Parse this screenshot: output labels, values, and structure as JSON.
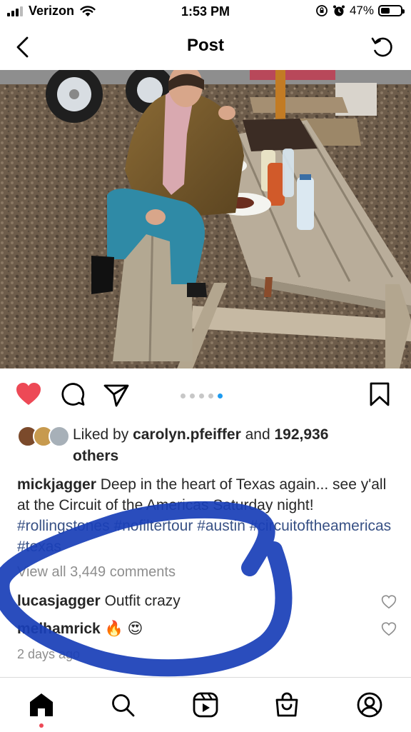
{
  "status_bar": {
    "carrier": "Verizon",
    "time": "1:53 PM",
    "battery_text": "47%",
    "battery_level": 0.47
  },
  "header": {
    "title": "Post"
  },
  "post": {
    "image_count": 5,
    "active_image_index": 4,
    "liked": true,
    "likes": {
      "prefix": "Liked by ",
      "user": "carolyn.pfeiffer",
      "middle": " and ",
      "count": "192,936",
      "suffix": "others"
    },
    "caption": {
      "author": "mickjagger",
      "text": " Deep in the heart of Texas again... see y'all at the Circuit of the Americas Saturday night! ",
      "hashtags": [
        "#rollingstones",
        "#nofiltertour",
        "#austin",
        "#circuitoftheamericas",
        "#texas"
      ]
    },
    "view_all_comments": "View all 3,449 comments",
    "comments": [
      {
        "user": "lucasjagger",
        "text": "Outfit crazy"
      },
      {
        "user": "melhamrick",
        "text": "🔥 😍"
      }
    ],
    "time_ago": "2 days ago"
  },
  "colors": {
    "like_red": "#ed4956",
    "link_blue": "#385185",
    "scribble_blue": "#1a3fb8",
    "dot_active": "#1d9bf0"
  },
  "tab_bar": {
    "items": [
      "home-icon",
      "search-icon",
      "reels-icon",
      "shop-icon",
      "profile-icon"
    ],
    "active": "home-icon"
  }
}
